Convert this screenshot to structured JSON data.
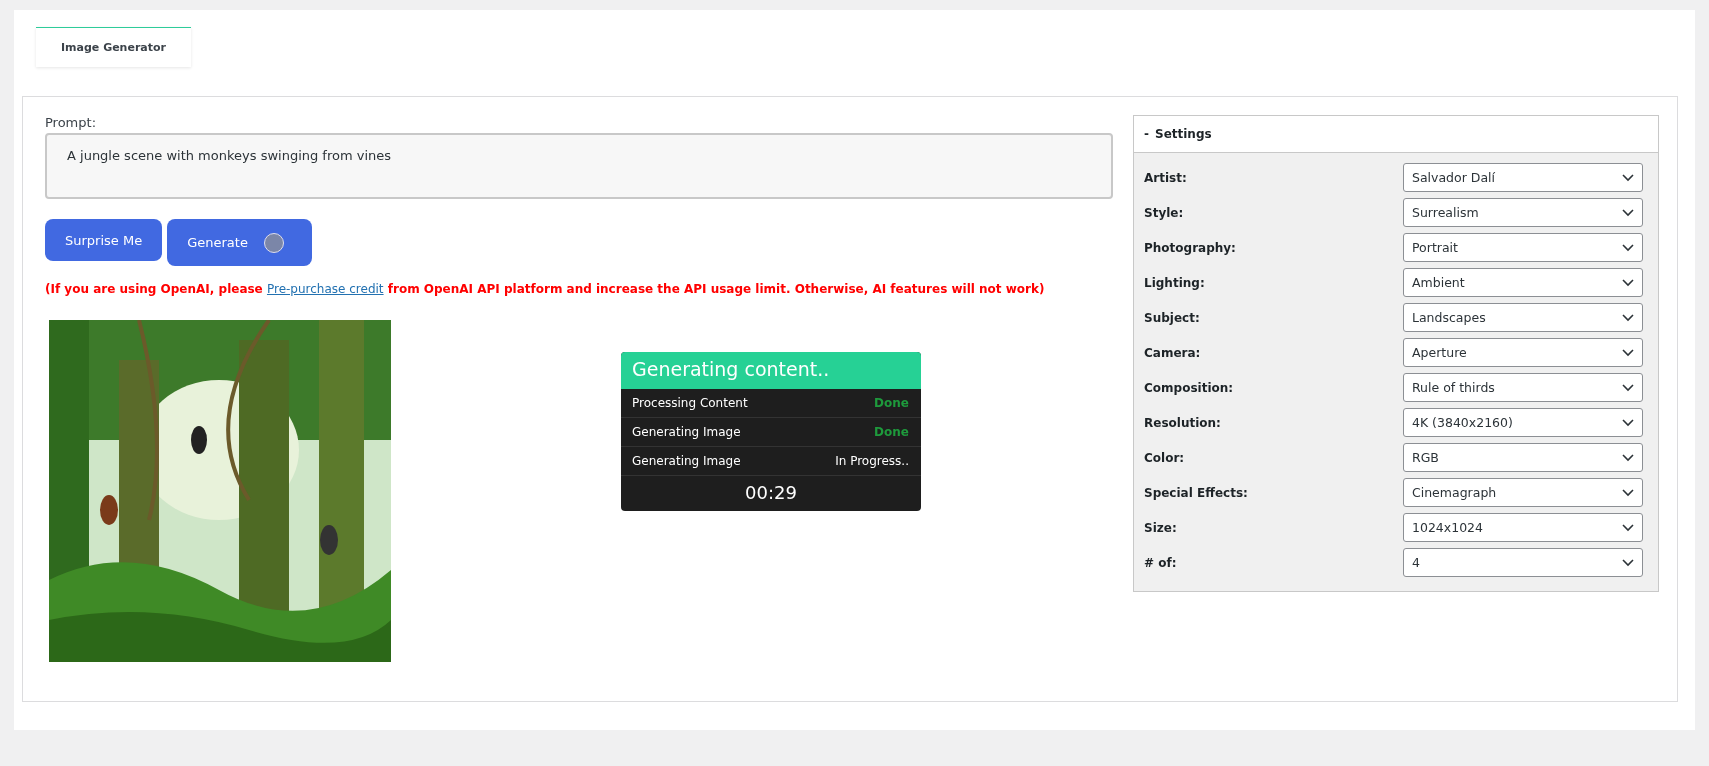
{
  "tabs": [
    {
      "label": "Image Generator",
      "selected": true
    }
  ],
  "prompt": {
    "label": "Prompt:",
    "value": "A jungle scene with monkeys swinging from vines"
  },
  "buttons": [
    {
      "label": "Surprise Me",
      "loading": false
    },
    {
      "label": "Generate",
      "loading": true
    }
  ],
  "notice": {
    "before": "(If you are using OpenAI, please",
    "link": "Pre-purchase credit",
    "after": "from OpenAI API platform and increase the API usage limit. Otherwise, AI features will not work)"
  },
  "progress": {
    "title": "Generating content..",
    "steps": [
      {
        "label": "Processing Content",
        "status": "Done",
        "done": true
      },
      {
        "label": "Generating Image",
        "status": "Done",
        "done": true
      },
      {
        "label": "Generating Image",
        "status": "In Progress..",
        "done": false
      }
    ],
    "timer": "00:29"
  },
  "settings": {
    "toggle": "-",
    "title": "Settings",
    "expanded": true,
    "fields": [
      {
        "label": "Artist:",
        "value": "Salvador Dalí"
      },
      {
        "label": "Style:",
        "value": "Surrealism"
      },
      {
        "label": "Photography:",
        "value": "Portrait"
      },
      {
        "label": "Lighting:",
        "value": "Ambient"
      },
      {
        "label": "Subject:",
        "value": "Landscapes"
      },
      {
        "label": "Camera:",
        "value": "Aperture"
      },
      {
        "label": "Composition:",
        "value": "Rule of thirds"
      },
      {
        "label": "Resolution:",
        "value": "4K (3840x2160)"
      },
      {
        "label": "Color:",
        "value": "RGB"
      },
      {
        "label": "Special Effects:",
        "value": "Cinemagraph"
      },
      {
        "label": "Size:",
        "value": "1024x1024"
      },
      {
        "label": "# of:",
        "value": "4"
      }
    ]
  }
}
